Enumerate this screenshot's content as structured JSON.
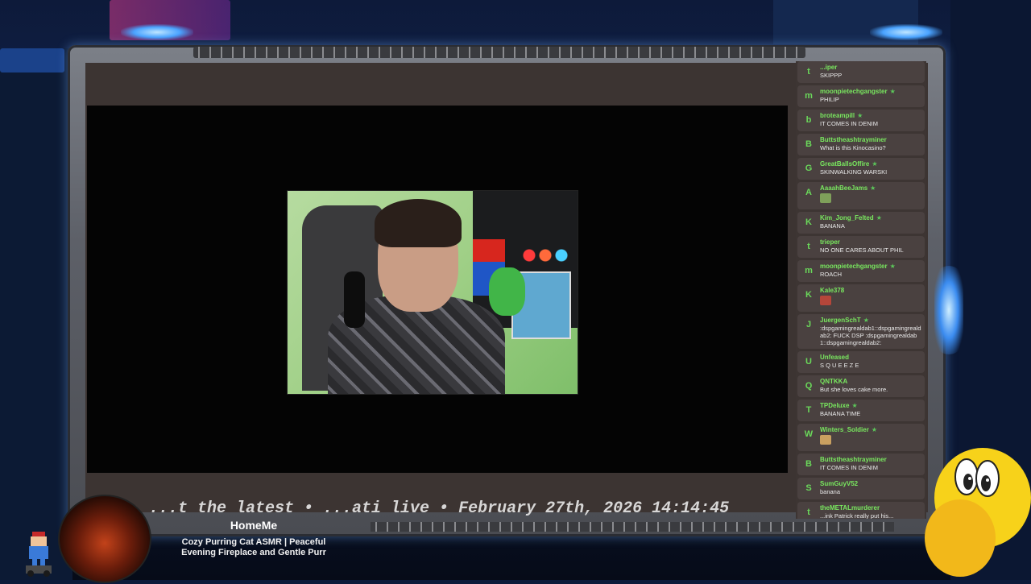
{
  "now_playing": {
    "title": "HomeMe",
    "subtitle": "Cozy Purring Cat ASMR | Peaceful Evening Fireplace and Gentle Purr"
  },
  "ticker": {
    "text": "...t the latest • ...ati live • February 27th, 2026 14:14:45"
  },
  "chat": {
    "messages": [
      {
        "avatar": "t",
        "user": "...iper",
        "star": false,
        "text": "SKIPPP"
      },
      {
        "avatar": "m",
        "user": "moonpietechgangster",
        "star": true,
        "text": "PHILIP"
      },
      {
        "avatar": "b",
        "user": "broteampill",
        "star": true,
        "text": "IT COMES IN DENIM"
      },
      {
        "avatar": "B",
        "user": "Buttstheashtrayminer",
        "star": false,
        "text": "What is this Kinocasino?"
      },
      {
        "avatar": "G",
        "user": "GreatBallsOffire",
        "star": true,
        "text": "SKINWALKING WARSKI"
      },
      {
        "avatar": "A",
        "user": "AaaahBeeJams",
        "star": true,
        "text": "",
        "emote": "emote-green"
      },
      {
        "avatar": "K",
        "user": "Kim_Jong_Felted",
        "star": true,
        "text": "BANANA"
      },
      {
        "avatar": "t",
        "user": "trieper",
        "star": false,
        "text": "NO ONE CARES ABOUT PHIL"
      },
      {
        "avatar": "m",
        "user": "moonpietechgangster",
        "star": true,
        "text": "ROACH"
      },
      {
        "avatar": "K",
        "user": "Kale378",
        "star": false,
        "text": "",
        "emote": "emote-red"
      },
      {
        "avatar": "J",
        "user": "JuergenSchT",
        "star": true,
        "text": ":dspgamingrealdab1::dspgamingrealdab2: FUCK DSP :dspgamingrealdab1::dspgamingrealdab2:"
      },
      {
        "avatar": "U",
        "user": "Unfeased",
        "star": false,
        "text": "S Q U E E Z E"
      },
      {
        "avatar": "Q",
        "user": "QNTKKA",
        "star": false,
        "text": "But she loves cake more."
      },
      {
        "avatar": "T",
        "user": "TPDeluxe",
        "star": true,
        "text": "BANANA TIME"
      },
      {
        "avatar": "W",
        "user": "Winters_Soldier",
        "star": true,
        "text": "",
        "emote": "emote-tan"
      },
      {
        "avatar": "B",
        "user": "Buttstheashtrayminer",
        "star": false,
        "text": "IT COMES IN DENIM"
      },
      {
        "avatar": "S",
        "user": "SumGuyV52",
        "star": false,
        "text": "banana"
      },
      {
        "avatar": "t",
        "user": "theMETALmurderer",
        "star": false,
        "text": "...ink Patrick really put his..."
      }
    ]
  },
  "colors": {
    "chat_username": "#79e85f",
    "chat_bg": "#3d3533",
    "frame_glow": "#4aa3ff"
  }
}
